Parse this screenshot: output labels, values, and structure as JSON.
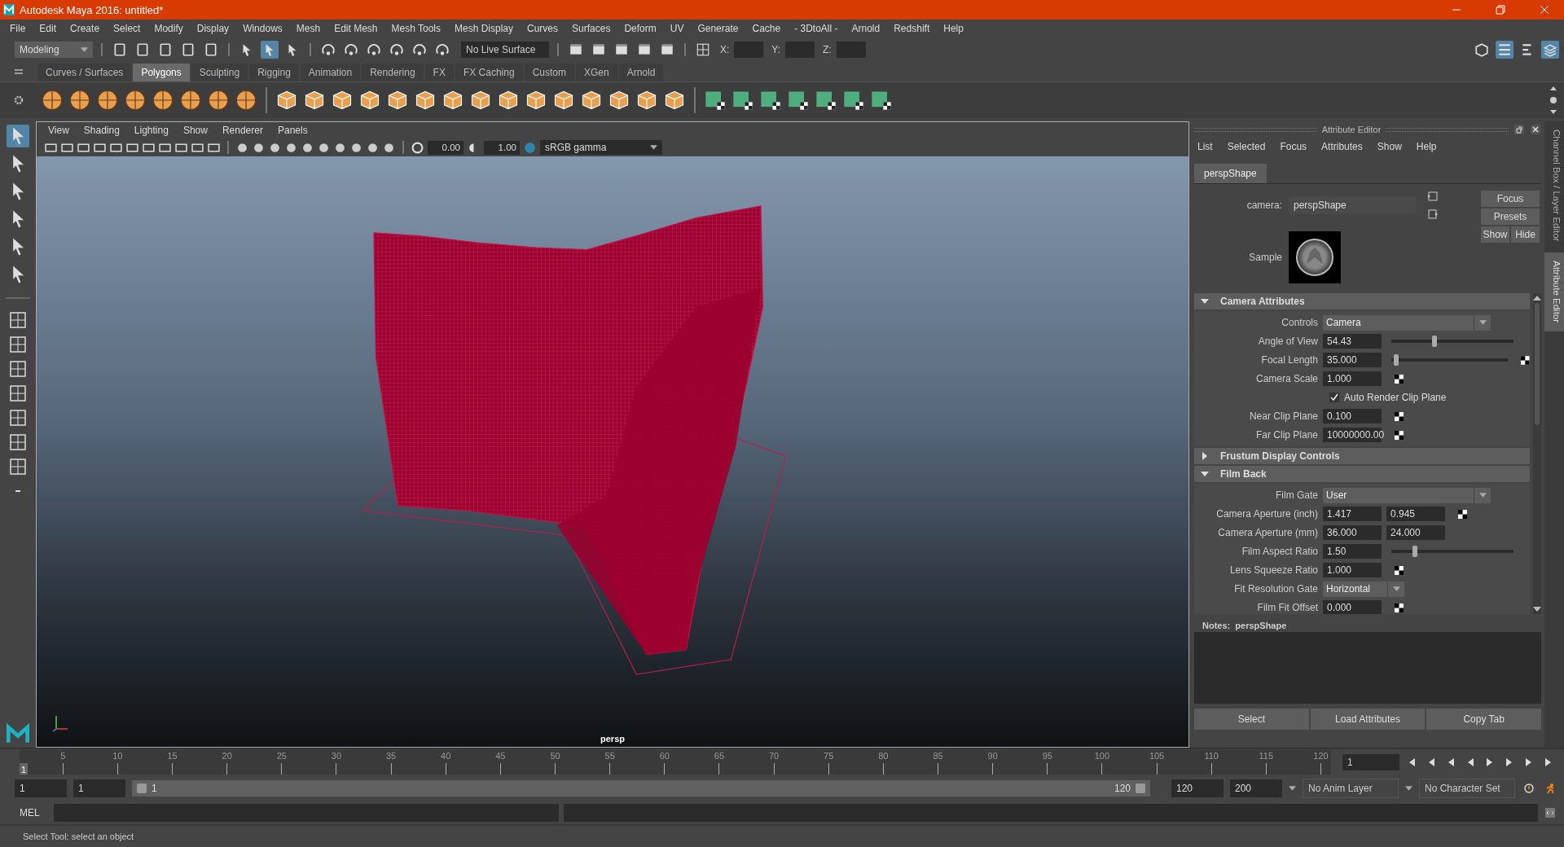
{
  "window": {
    "title": "Autodesk Maya 2016: untitled*"
  },
  "menu_bar": [
    "File",
    "Edit",
    "Create",
    "Select",
    "Modify",
    "Display",
    "Windows",
    "Mesh",
    "Edit Mesh",
    "Mesh Tools",
    "Mesh Display",
    "Curves",
    "Surfaces",
    "Deform",
    "UV",
    "Generate",
    "Cache",
    "- 3DtoAll -",
    "Arnold",
    "Redshift",
    "Help"
  ],
  "status_line": {
    "menu_set": "Modeling",
    "live_surface": "No Live Surface",
    "coords": [
      {
        "label": "X:"
      },
      {
        "label": "Y:"
      },
      {
        "label": "Z:"
      }
    ]
  },
  "shelf": {
    "tabs": [
      {
        "label": "Curves / Surfaces",
        "selected": false
      },
      {
        "label": "Polygons",
        "selected": true
      },
      {
        "label": "Sculpting",
        "selected": false
      },
      {
        "label": "Rigging",
        "selected": false
      },
      {
        "label": "Animation",
        "selected": false
      },
      {
        "label": "Rendering",
        "selected": false
      },
      {
        "label": "FX",
        "selected": false
      },
      {
        "label": "FX Caching",
        "selected": false
      },
      {
        "label": "Custom",
        "selected": false
      },
      {
        "label": "XGen",
        "selected": false
      },
      {
        "label": "Arnold",
        "selected": false
      }
    ]
  },
  "viewport": {
    "menu": [
      "View",
      "Shading",
      "Lighting",
      "Show",
      "Renderer",
      "Panels"
    ],
    "exposure": "0.00",
    "gamma": "1.00",
    "color_space": "sRGB gamma",
    "camera": "persp"
  },
  "attribute_editor": {
    "title": "Attribute Editor",
    "menu": [
      "List",
      "Selected",
      "Focus",
      "Attributes",
      "Show",
      "Help"
    ],
    "node_tabs": [
      {
        "label": "perspShape",
        "selected": true
      }
    ],
    "camera_label": "camera:",
    "camera_value": "perspShape",
    "buttons": [
      "Focus",
      "Presets",
      "Show",
      "Hide"
    ],
    "sample_label": "Sample",
    "sections": [
      {
        "title": "Camera Attributes",
        "expanded": true,
        "rows": [
          {
            "kind": "dropdown",
            "label": "Controls",
            "value": "Camera",
            "wide": true
          },
          {
            "kind": "slider",
            "label": "Angle of View",
            "value": "54.43",
            "level": 0.33,
            "connectable": false
          },
          {
            "kind": "slider",
            "label": "Focal Length",
            "value": "35.000",
            "level": 0.02,
            "connectable": true
          },
          {
            "kind": "field",
            "label": "Camera Scale",
            "value": "1.000",
            "connectable": true
          },
          {
            "kind": "checkbox",
            "label": "Auto Render Clip Plane",
            "checked": true
          },
          {
            "kind": "field",
            "label": "Near Clip Plane",
            "value": "0.100",
            "connectable": true
          },
          {
            "kind": "field",
            "label": "Far Clip Plane",
            "value": "10000000.00",
            "connectable": true
          }
        ]
      },
      {
        "title": "Frustum Display Controls",
        "expanded": false
      },
      {
        "title": "Film Back",
        "expanded": true,
        "rows": [
          {
            "kind": "dropdown",
            "label": "Film Gate",
            "value": "User",
            "wide": true
          },
          {
            "kind": "pair",
            "label": "Camera Aperture (inch)",
            "values": [
              "1.417",
              "0.945"
            ],
            "connectable": true
          },
          {
            "kind": "pair",
            "label": "Camera Aperture (mm)",
            "values": [
              "36.000",
              "24.000"
            ],
            "connectable": false
          },
          {
            "kind": "slider",
            "label": "Film Aspect Ratio",
            "value": "1.50",
            "level": 0.17,
            "connectable": false
          },
          {
            "kind": "field",
            "label": "Lens Squeeze Ratio",
            "value": "1.000",
            "connectable": true
          },
          {
            "kind": "dropdown",
            "label": "Fit Resolution Gate",
            "value": "Horizontal",
            "wide": false
          },
          {
            "kind": "field",
            "label": "Film Fit Offset",
            "value": "0.000",
            "connectable": true
          }
        ]
      }
    ],
    "notes": "Notes:  perspShape",
    "bottom_buttons": [
      "Select",
      "Load Attributes",
      "Copy Tab"
    ]
  },
  "side_tabs": [
    {
      "label": "Channel Box / Layer Editor",
      "selected": false
    },
    {
      "label": "Attribute Editor",
      "selected": true
    }
  ],
  "timeline": {
    "ticks": [
      "5",
      "10",
      "15",
      "20",
      "25",
      "30",
      "35",
      "40",
      "45",
      "50",
      "55",
      "60",
      "65",
      "70",
      "75",
      "80",
      "85",
      "90",
      "95",
      "100",
      "105",
      "110",
      "115",
      "120"
    ],
    "current": "1",
    "level": 0,
    "current_field": "1"
  },
  "range": {
    "start": "1",
    "playback_start": "1",
    "level": 1,
    "slider_start": "1",
    "slider_end": "120",
    "playback_end": "120",
    "end": "200",
    "anim_layer": "No Anim Layer",
    "character_set": "No Character Set"
  },
  "command_line": {
    "language": "MEL"
  },
  "help_line": "Select Tool: select an object"
}
